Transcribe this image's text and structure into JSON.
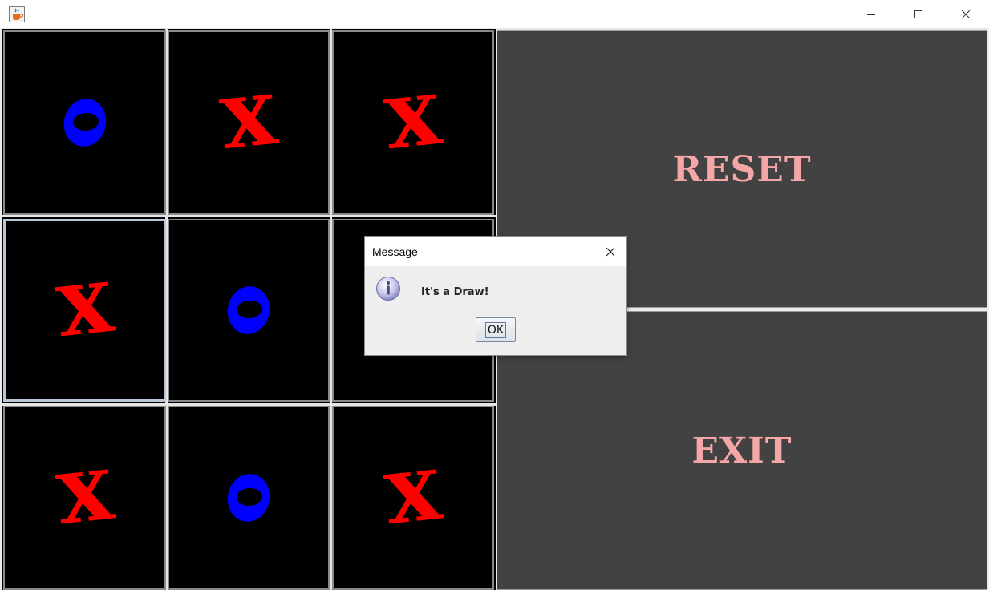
{
  "window": {
    "title": "",
    "icon": "java-cup-icon",
    "controls": [
      "minimize-icon",
      "maximize-icon",
      "close-icon"
    ]
  },
  "board": {
    "cells": [
      "O",
      "X",
      "X",
      "X",
      "O",
      "",
      "X",
      "O",
      "X"
    ],
    "selected_index": 3,
    "colors": {
      "x": "#ff0000",
      "o": "#0000ff",
      "background": "#000000"
    }
  },
  "side_panel": {
    "reset_label": "RESET",
    "exit_label": "EXIT",
    "colors": {
      "button_bg": "#424242",
      "label": "#f4a7a6"
    }
  },
  "dialog": {
    "title": "Message",
    "message": "It's a  Draw!",
    "ok_label": "OK",
    "icon": "info-icon"
  }
}
